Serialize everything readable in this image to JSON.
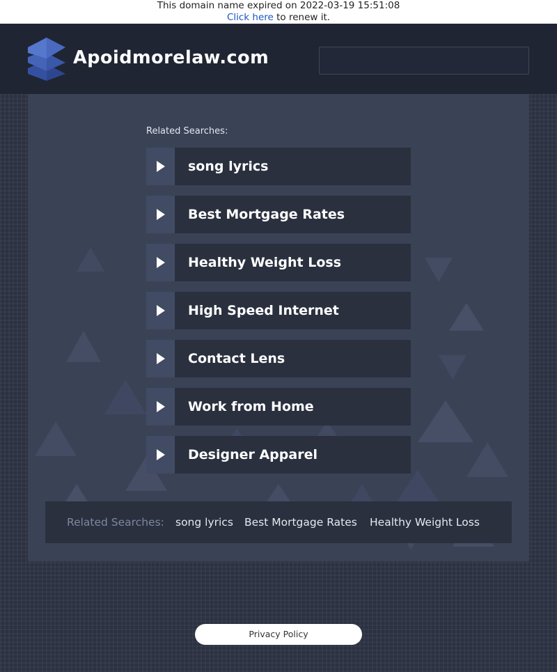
{
  "banner": {
    "expired_text": "This domain name expired on 2022-03-19 15:51:08",
    "renew_link": "Click here",
    "renew_suffix": " to renew it."
  },
  "header": {
    "logo_icon": "stacked-layers-icon",
    "site_title": "Apoidmorelaw.com",
    "search_value": ""
  },
  "related": {
    "label": "Related Searches:",
    "items": [
      {
        "label": "song lyrics"
      },
      {
        "label": "Best Mortgage Rates"
      },
      {
        "label": "Healthy Weight Loss"
      },
      {
        "label": "High Speed Internet"
      },
      {
        "label": "Contact Lens"
      },
      {
        "label": "Work from Home"
      },
      {
        "label": "Designer Apparel"
      }
    ],
    "item_icon": "play-arrow-icon"
  },
  "footer_links": {
    "label": "Related Searches:",
    "links": [
      "song lyrics",
      "Best Mortgage Rates",
      "Healthy Weight Loss"
    ]
  },
  "privacy": {
    "label": "Privacy Policy"
  },
  "colors": {
    "page_bg": "#2b3140",
    "header_bg": "#1f2533",
    "panel_bg": "#3a4256",
    "result_bg": "#2a303e",
    "arrow_bg": "#424b64",
    "logo_blue": "#3a57a8"
  }
}
